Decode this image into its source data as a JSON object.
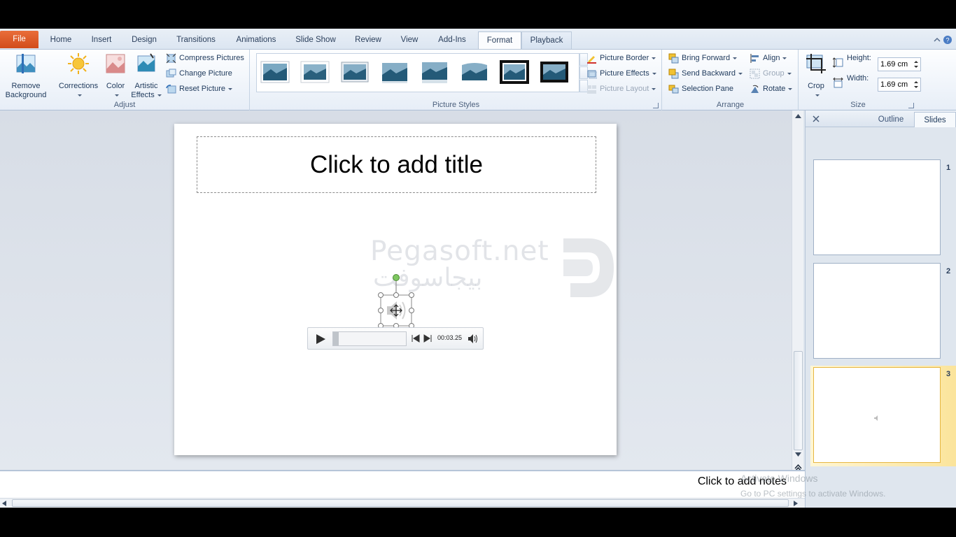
{
  "tabs": [
    "File",
    "Home",
    "Insert",
    "Design",
    "Transitions",
    "Animations",
    "Slide Show",
    "Review",
    "View",
    "Add-Ins",
    "Format",
    "Playback"
  ],
  "active_tab": "Format",
  "ribbon": {
    "adjust": {
      "remove_background_line1": "Remove",
      "remove_background_line2": "Background",
      "corrections": "Corrections",
      "color": "Color",
      "artistic_line1": "Artistic",
      "artistic_line2": "Effects",
      "compress": "Compress Pictures",
      "change": "Change Picture",
      "reset": "Reset Picture",
      "label": "Adjust"
    },
    "picture_styles": {
      "label": "Picture Styles",
      "border": "Picture Border",
      "effects": "Picture Effects",
      "layout": "Picture Layout"
    },
    "arrange": {
      "bring_forward": "Bring Forward",
      "send_backward": "Send Backward",
      "selection_pane": "Selection Pane",
      "align": "Align",
      "group": "Group",
      "rotate": "Rotate",
      "label": "Arrange"
    },
    "size": {
      "crop": "Crop",
      "height_label": "Height:",
      "height_value": "1.69 cm",
      "width_label": "Width:",
      "width_value": "1.69 cm",
      "label": "Size"
    }
  },
  "slide": {
    "title_placeholder": "Click to add title",
    "media_time": "00:03.25",
    "media_progress": 0.08
  },
  "watermark": {
    "text": "Pegasoft.net",
    "arabic": "بيجاسوفت"
  },
  "side_panel": {
    "tab_outline": "Outline",
    "tab_slides": "Slides",
    "slides": [
      "1",
      "2",
      "3"
    ],
    "selected_slide": "3"
  },
  "notes_placeholder": "Click to add notes",
  "activate_windows": {
    "line1": "Activate Windows",
    "line2": "Go to PC settings to activate Windows."
  },
  "colors": {
    "file_tab": "#d24c1a",
    "ribbon_bg": "#e7eef7",
    "selected_slide": "#fbe49b"
  }
}
